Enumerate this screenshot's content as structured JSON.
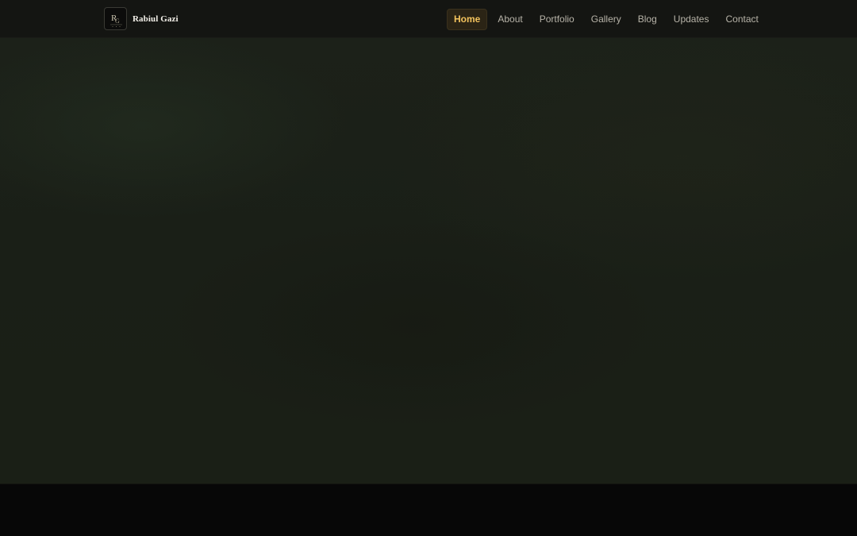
{
  "brand": {
    "name": "Rabiul Gazi",
    "logo_icon": "rg-monogram-logo"
  },
  "nav": {
    "items": [
      {
        "label": "Home",
        "active": true
      },
      {
        "label": "About",
        "active": false
      },
      {
        "label": "Portfolio",
        "active": false
      },
      {
        "label": "Gallery",
        "active": false
      },
      {
        "label": "Blog",
        "active": false
      },
      {
        "label": "Updates",
        "active": false
      },
      {
        "label": "Contact",
        "active": false
      }
    ]
  },
  "colors": {
    "accent": "#f3c35d",
    "nav_text": "#b7b3a8",
    "background": "#070707",
    "hero": "#1a1f17"
  }
}
